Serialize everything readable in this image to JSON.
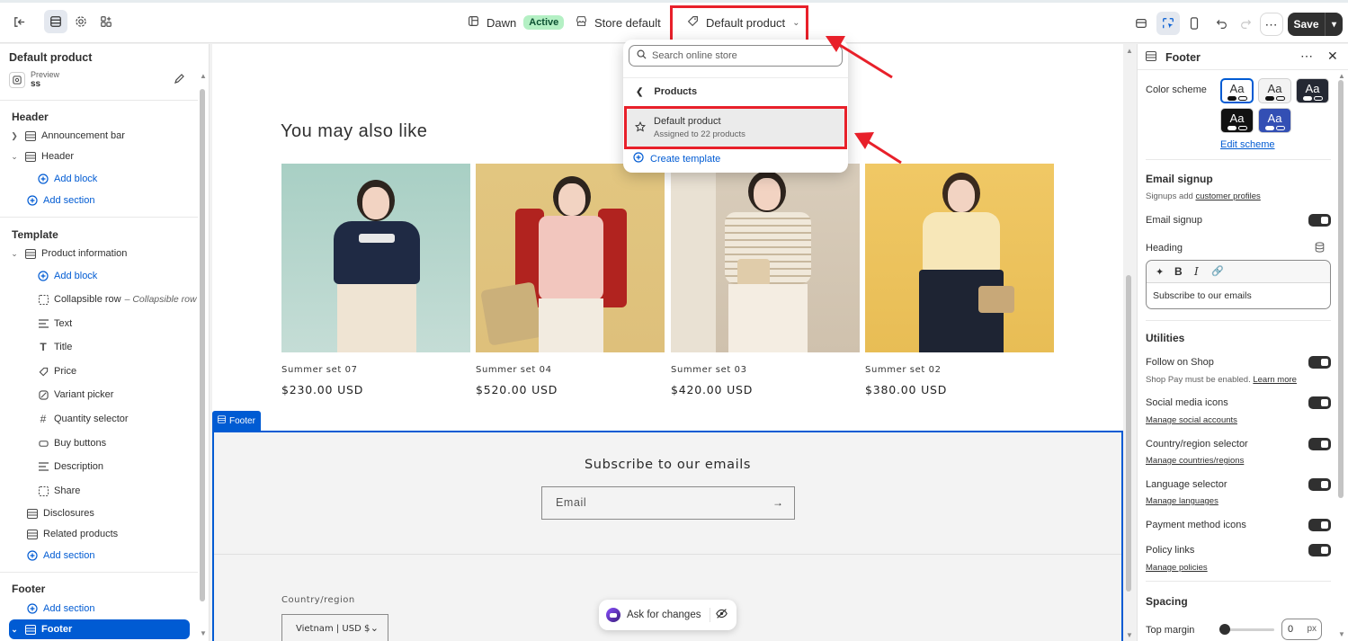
{
  "topbar": {
    "theme_name": "Dawn",
    "theme_status": "Active",
    "store_label": "Store default",
    "template_label": "Default product",
    "save_label": "Save"
  },
  "dropdown": {
    "search_placeholder": "Search online store",
    "back_label": "Products",
    "item_title": "Default product",
    "item_subtitle": "Assigned to 22 products",
    "create_label": "Create template"
  },
  "left": {
    "title": "Default product",
    "preview_label": "Preview",
    "preview_value": "ss",
    "header_group": "Header",
    "template_group": "Template",
    "footer_group": "Footer",
    "items": {
      "announcement_bar": "Announcement bar",
      "header": "Header",
      "add_block": "Add block",
      "add_section": "Add section",
      "product_information": "Product information",
      "collapsible_row": "Collapsible row",
      "collapsible_row_sub": "– Collapsible row",
      "text": "Text",
      "title": "Title",
      "price": "Price",
      "variant_picker": "Variant picker",
      "quantity_selector": "Quantity selector",
      "buy_buttons": "Buy buttons",
      "description": "Description",
      "share": "Share",
      "disclosures": "Disclosures",
      "related_products": "Related products",
      "footer": "Footer"
    }
  },
  "preview": {
    "heading": "You may also like",
    "products": [
      {
        "name": "Summer set 07",
        "price": "$230.00 USD"
      },
      {
        "name": "Summer set 04",
        "price": "$520.00 USD"
      },
      {
        "name": "Summer set 03",
        "price": "$420.00 USD"
      },
      {
        "name": "Summer set 02",
        "price": "$380.00 USD"
      }
    ],
    "footer_tag": "Footer",
    "subscribe_heading": "Subscribe to our emails",
    "email_placeholder": "Email",
    "country_label": "Country/region",
    "country_value": "Vietnam | USD $",
    "ask_label": "Ask for changes"
  },
  "right": {
    "title": "Footer",
    "color_scheme_label": "Color scheme",
    "swatch_text": "Aa",
    "edit_scheme": "Edit scheme",
    "email_signup_head": "Email signup",
    "signups_prefix": "Signups add",
    "signups_link": "customer profiles",
    "email_signup_toggle": "Email signup",
    "heading_label": "Heading",
    "heading_value": "Subscribe to our emails",
    "utilities_head": "Utilities",
    "follow_shop": "Follow on Shop",
    "shop_pay_note": "Shop Pay must be enabled.",
    "learn_more": "Learn more",
    "social_icons": "Social media icons",
    "manage_social": "Manage social accounts",
    "country_selector": "Country/region selector",
    "manage_countries": "Manage countries/regions",
    "language_selector": "Language selector",
    "manage_languages": "Manage languages",
    "payment_icons": "Payment method icons",
    "policy_links": "Policy links",
    "manage_policies": "Manage policies",
    "spacing_head": "Spacing",
    "top_margin": "Top margin",
    "top_margin_value": "0",
    "top_margin_unit": "px"
  },
  "colors": {
    "accent": "#005bd3",
    "highlight": "#e8202a",
    "active_badge": "#b4f0c4"
  }
}
